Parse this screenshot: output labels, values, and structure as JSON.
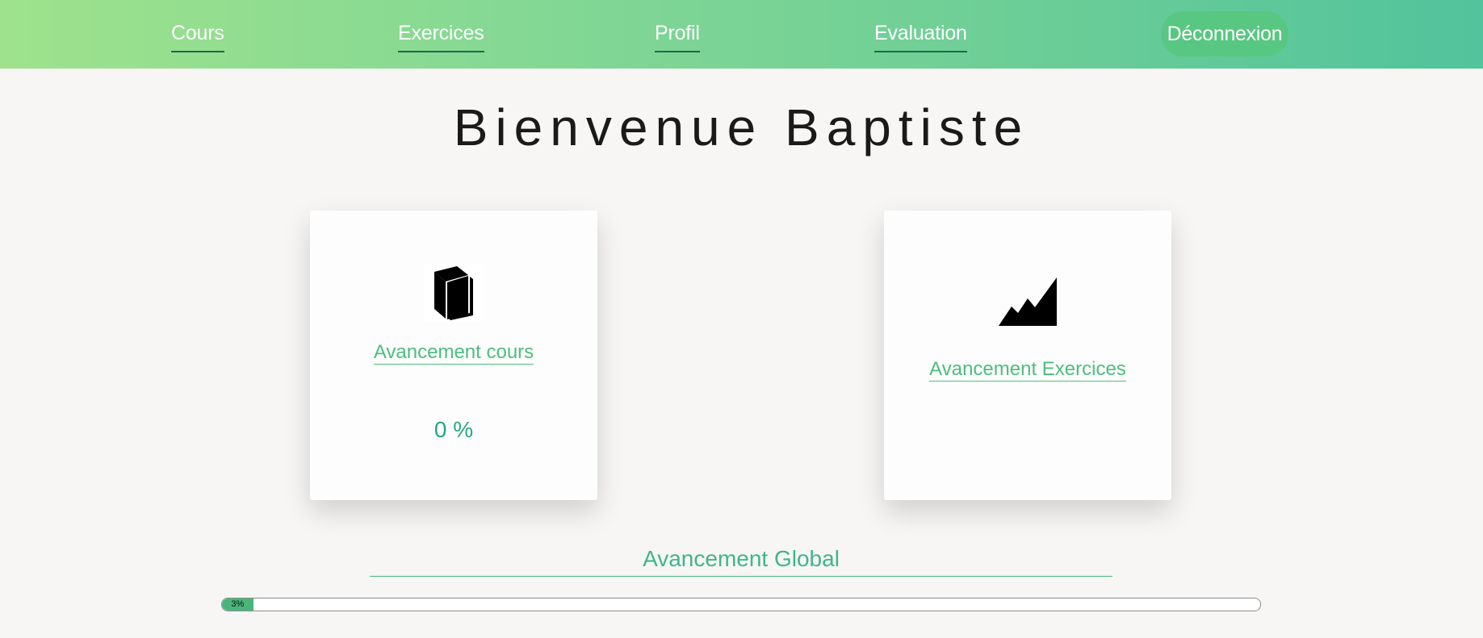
{
  "nav": {
    "items": [
      {
        "label": "Cours"
      },
      {
        "label": "Exercices"
      },
      {
        "label": "Profil"
      },
      {
        "label": "Evaluation"
      }
    ],
    "logout_label": "Déconnexion"
  },
  "welcome": {
    "title": "Bienvenue Baptiste"
  },
  "cards": {
    "courses": {
      "icon": "book-icon",
      "link_label": "Avancement cours",
      "percent_text": "0 %"
    },
    "exercises": {
      "icon": "chart-area-icon",
      "link_label": "Avancement Exercices"
    }
  },
  "global_progress": {
    "title": "Avancement Global",
    "value": 0.03,
    "label": "3%"
  },
  "colors": {
    "accent_green": "#4cbe7d",
    "logout_bg": "#58c782",
    "header_gradient_start": "#9ee28c",
    "header_gradient_end": "#52c39c"
  }
}
